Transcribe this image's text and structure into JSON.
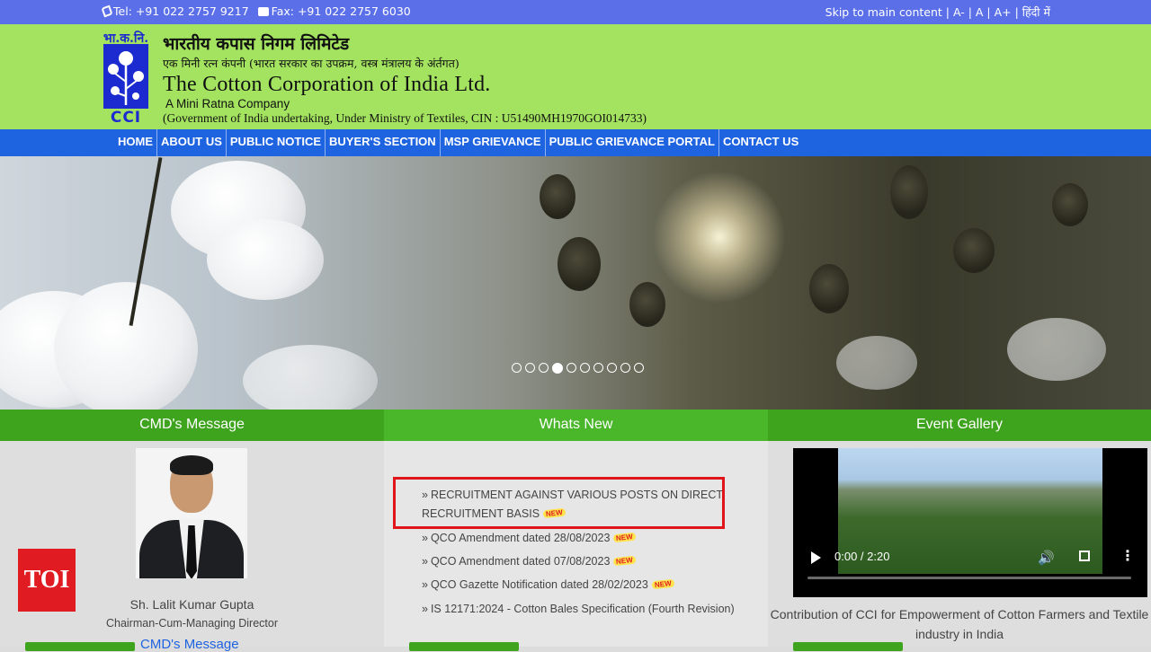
{
  "topbar": {
    "tel": "Tel: +91 022 2757 9217",
    "fax": "Fax: +91 022 2757 6030",
    "accessibility": "Skip to main content | A- | A | A+ | हिंदी में"
  },
  "header": {
    "logo_devanagari": "भा.क.नि.",
    "logo_text": "CCI",
    "title_hindi": "भारतीय कपास निगम लिमिटेड",
    "subtitle_hindi": "एक मिनी रत्न कंपनी (भारत सरकार का उपक्रम, वस्त्र मंत्रालय के अंर्तगत)",
    "title_english": "The Cotton Corporation of India Ltd.",
    "tagline": "A Mini Ratna Company",
    "govt_line": "(Government of India undertaking, Under Ministry of Textiles, CIN : U51490MH1970GOI014733)"
  },
  "nav": {
    "items": [
      "HOME",
      "ABOUT US",
      "PUBLIC NOTICE",
      "BUYER'S SECTION",
      "MSP GRIEVANCE",
      "PUBLIC GRIEVANCE PORTAL",
      "CONTACT US"
    ]
  },
  "slider": {
    "count": 10,
    "active_index": 3
  },
  "panels": {
    "cmd": {
      "heading": "CMD's Message",
      "name": "Sh. Lalit Kumar Gupta",
      "role": "Chairman-Cum-Managing Director",
      "link": "CMD's Message"
    },
    "whats_new": {
      "heading": "Whats New",
      "items": [
        {
          "line1": "RECRUITMENT AGAINST VARIOUS POSTS ON DIRECT",
          "line2": "RECRUITMENT BASIS",
          "badge": "NEW"
        },
        {
          "line1": "QCO Amendment dated 28/08/2023",
          "badge": "NEW"
        },
        {
          "line1": "QCO Amendment dated 07/08/2023",
          "badge": "NEW"
        },
        {
          "line1": "QCO Gazette Notification dated 28/02/2023",
          "badge": "NEW"
        },
        {
          "line1": "IS 12171:2024 - Cotton Bales Specification (Fourth Revision)"
        }
      ]
    },
    "gallery": {
      "heading": "Event Gallery",
      "video_time": "0:00 / 2:20",
      "caption": "Contribution of CCI for Empowerment of Cotton Farmers and Textile industry in India"
    }
  },
  "watermark": "TOI",
  "colors": {
    "topbar": "#5b6fe8",
    "header": "#a3e35f",
    "nav": "#1e63e0",
    "panel_head": "#3ea31d",
    "highlight": "#e0141b"
  }
}
